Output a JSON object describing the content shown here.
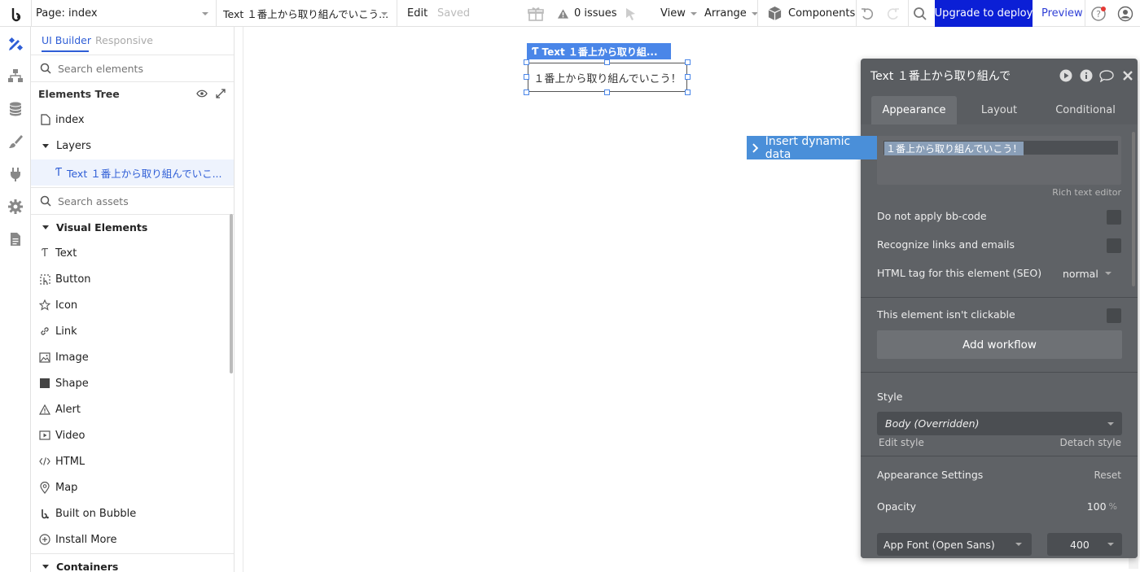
{
  "topbar": {
    "page_label": "Page: index",
    "element_label": "Text １番上から取り組んでいこう...",
    "edit_label": "Edit",
    "saved_label": "Saved",
    "issues_label": "0 issues",
    "view_label": "View",
    "arrange_label": "Arrange",
    "components_label": "Components",
    "upgrade_label": "Upgrade to deploy",
    "preview_label": "Preview"
  },
  "sidebar": {
    "tabs": [
      "UI Builder",
      "Responsive"
    ],
    "search_elements_placeholder": "Search elements",
    "elements_tree_title": "Elements Tree",
    "tree": {
      "page": "index",
      "layers": "Layers",
      "selected_item": "Text １番上から取り組んでいこ..."
    },
    "search_assets_placeholder": "Search assets",
    "visual_elements_title": "Visual Elements",
    "visual_elements": [
      {
        "label": "Text",
        "icon": "text-icon"
      },
      {
        "label": "Button",
        "icon": "button-icon"
      },
      {
        "label": "Icon",
        "icon": "star-icon"
      },
      {
        "label": "Link",
        "icon": "link-icon"
      },
      {
        "label": "Image",
        "icon": "image-icon"
      },
      {
        "label": "Shape",
        "icon": "shape-icon"
      },
      {
        "label": "Alert",
        "icon": "alert-icon"
      },
      {
        "label": "Video",
        "icon": "video-icon"
      },
      {
        "label": "HTML",
        "icon": "code-icon"
      },
      {
        "label": "Map",
        "icon": "map-pin-icon"
      },
      {
        "label": "Built on Bubble",
        "icon": "bubble-logo-icon"
      },
      {
        "label": "Install More",
        "icon": "plus-circle-icon"
      }
    ],
    "containers_title": "Containers"
  },
  "canvas": {
    "selection_tag": "Text １番上から取り組...",
    "element_text": "１番上から取り組んでいこう！"
  },
  "panel": {
    "title": "Text １番上から取り組んで",
    "tabs": [
      "Appearance",
      "Layout",
      "Conditional"
    ],
    "insert_dynamic_data": "Insert dynamic data",
    "text_value": "１番上から取り組んでいこう！",
    "rich_text_editor": "Rich text editor",
    "do_not_apply_bbcode": "Do not apply bb-code",
    "recognize_links": "Recognize links and emails",
    "html_tag_label": "HTML tag for this element (SEO)",
    "html_tag_value": "normal",
    "not_clickable": "This element isn't clickable",
    "add_workflow": "Add workflow",
    "style_label": "Style",
    "style_value": "Body (Overridden)",
    "edit_style": "Edit style",
    "detach_style": "Detach style",
    "appearance_settings": "Appearance Settings",
    "reset": "Reset",
    "opacity_label": "Opacity",
    "opacity_value": "100",
    "opacity_unit": "%",
    "font_value": "App Font (Open Sans)",
    "weight_value": "400"
  },
  "colors": {
    "accent_blue": "#2f5ed6",
    "upgrade_bg": "#0b1fd6",
    "selection_blue": "#4a86e8",
    "panel_bg": "#5a5d61"
  }
}
